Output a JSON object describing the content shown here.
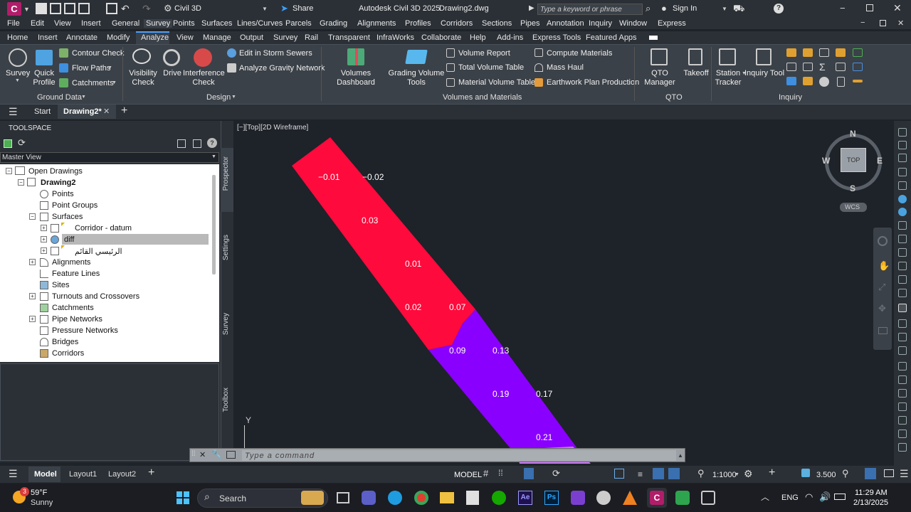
{
  "titlebar": {
    "app_letter": "C",
    "workspace": "Civil 3D",
    "share": "Share",
    "title": "Autodesk Civil 3D 2025",
    "drawing": "Drawing2.dwg",
    "search_placeholder": "Type a keyword or phrase",
    "signin": "Sign In"
  },
  "menu": [
    "File",
    "Edit",
    "View",
    "Insert",
    "General",
    "Survey",
    "Points",
    "Surfaces",
    "Lines/Curves",
    "Parcels",
    "Grading",
    "Alignments",
    "Profiles",
    "Corridors",
    "Sections",
    "Pipes",
    "Annotation",
    "Inquiry",
    "Window",
    "Express"
  ],
  "ribbon_tabs": [
    "Home",
    "Insert",
    "Annotate",
    "Modify",
    "Analyze",
    "View",
    "Manage",
    "Output",
    "Survey",
    "Rail",
    "Transparent",
    "InfraWorks",
    "Collaborate",
    "Help",
    "Add-ins",
    "Express Tools",
    "Featured Apps"
  ],
  "ribbon": {
    "survey": "Survey",
    "quick_profile": [
      "Quick",
      "Profile"
    ],
    "contour_check": "Contour Check",
    "flow_paths": "Flow Paths",
    "catchments": "Catchments",
    "ground_data": "Ground Data",
    "visibility_check": [
      "Visibility",
      "Check"
    ],
    "drive": "Drive",
    "interference_check": [
      "Interference",
      "Check"
    ],
    "edit_storm": "Edit in Storm Sewers",
    "analyze_gravity": "Analyze Gravity Network",
    "design": "Design",
    "volumes_dashboard": "Volumes Dashboard",
    "grading_volume_tools": [
      "Grading Volume",
      "Tools"
    ],
    "volume_report": "Volume Report",
    "total_volume_table": "Total Volume Table",
    "material_volume_table": "Material Volume Table",
    "compute_materials": "Compute Materials",
    "mass_haul": "Mass Haul",
    "earthwork_plan": "Earthwork Plan Production",
    "volumes_materials": "Volumes and Materials",
    "qto_manager": "QTO Manager",
    "takeoff": "Takeoff",
    "qto": "QTO",
    "station_tracker": [
      "Station",
      "Tracker"
    ],
    "inquiry_tool": "Inquiry Tool",
    "inquiry": "Inquiry"
  },
  "doctabs": {
    "start": "Start",
    "drawing": "Drawing2*"
  },
  "toolspace": {
    "title": "TOOLSPACE",
    "view": "Master View",
    "tree": [
      "Open Drawings",
      "Drawing2",
      "Points",
      "Point Groups",
      "Surfaces",
      "Corridor - datum",
      "diff",
      "الرئيسي القائم",
      "Alignments",
      "Feature Lines",
      "Sites",
      "Turnouts and Crossovers",
      "Catchments",
      "Pipe Networks",
      "Pressure Networks",
      "Bridges",
      "Corridors"
    ]
  },
  "vtabs": [
    "Prospector",
    "Settings",
    "Survey",
    "Toolbox"
  ],
  "viewport": {
    "label": "[−][Top][2D Wireframe]",
    "compass": {
      "n": "N",
      "s": "S",
      "e": "E",
      "w": "W",
      "top": "TOP",
      "wcs": "WCS"
    },
    "y_axis": "Y",
    "command_placeholder": "Type a command",
    "surface_labels": [
      "−0.01",
      "−0.02",
      "0.03",
      "0.01",
      "0.02",
      "0.07",
      "0.09",
      "0.13",
      "0.19",
      "0.17",
      "0.21"
    ]
  },
  "status": {
    "model_tab": "Model",
    "layout1": "Layout1",
    "layout2": "Layout2",
    "model": "MODEL",
    "scale": "1:1000",
    "elev": "3.500"
  },
  "taskbar": {
    "temp": "59°F",
    "weather": "Sunny",
    "badge": "3",
    "search": "Search",
    "lang": "ENG",
    "time": "11:29 AM",
    "date": "2/13/2025"
  },
  "colors": {
    "red_zone": "#ff0a3c",
    "purple_zone": "#8a00ff",
    "light_purple": "#d07bff",
    "accent": "#2a7fff"
  }
}
